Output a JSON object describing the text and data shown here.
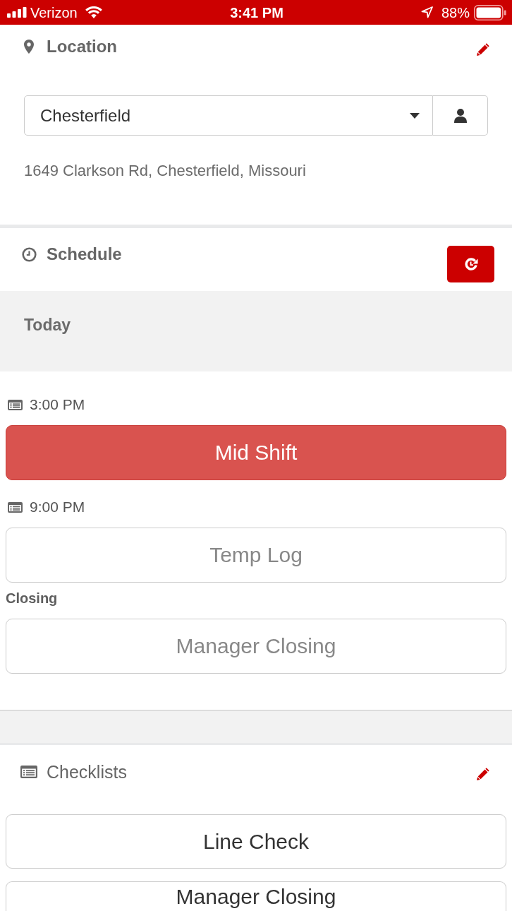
{
  "status_bar": {
    "carrier": "Verizon",
    "time": "3:41 PM",
    "battery": "88%"
  },
  "location": {
    "title": "Location",
    "select": {
      "value": "Chesterfield"
    },
    "address": "1649 Clarkson Rd, Chesterfield, Missouri"
  },
  "schedule": {
    "title": "Schedule",
    "day": "Today",
    "entries": [
      {
        "kind": "time",
        "text": "3:00 PM"
      },
      {
        "kind": "task",
        "label": "Mid Shift",
        "selected": true
      },
      {
        "kind": "time",
        "text": "9:00 PM"
      },
      {
        "kind": "task",
        "label": "Temp Log",
        "selected": false
      },
      {
        "kind": "group",
        "text": "Closing"
      },
      {
        "kind": "task",
        "label": "Manager Closing",
        "selected": false
      }
    ]
  },
  "checklists": {
    "title": "Checklists",
    "items": [
      "Line Check",
      "Manager Closing"
    ]
  }
}
